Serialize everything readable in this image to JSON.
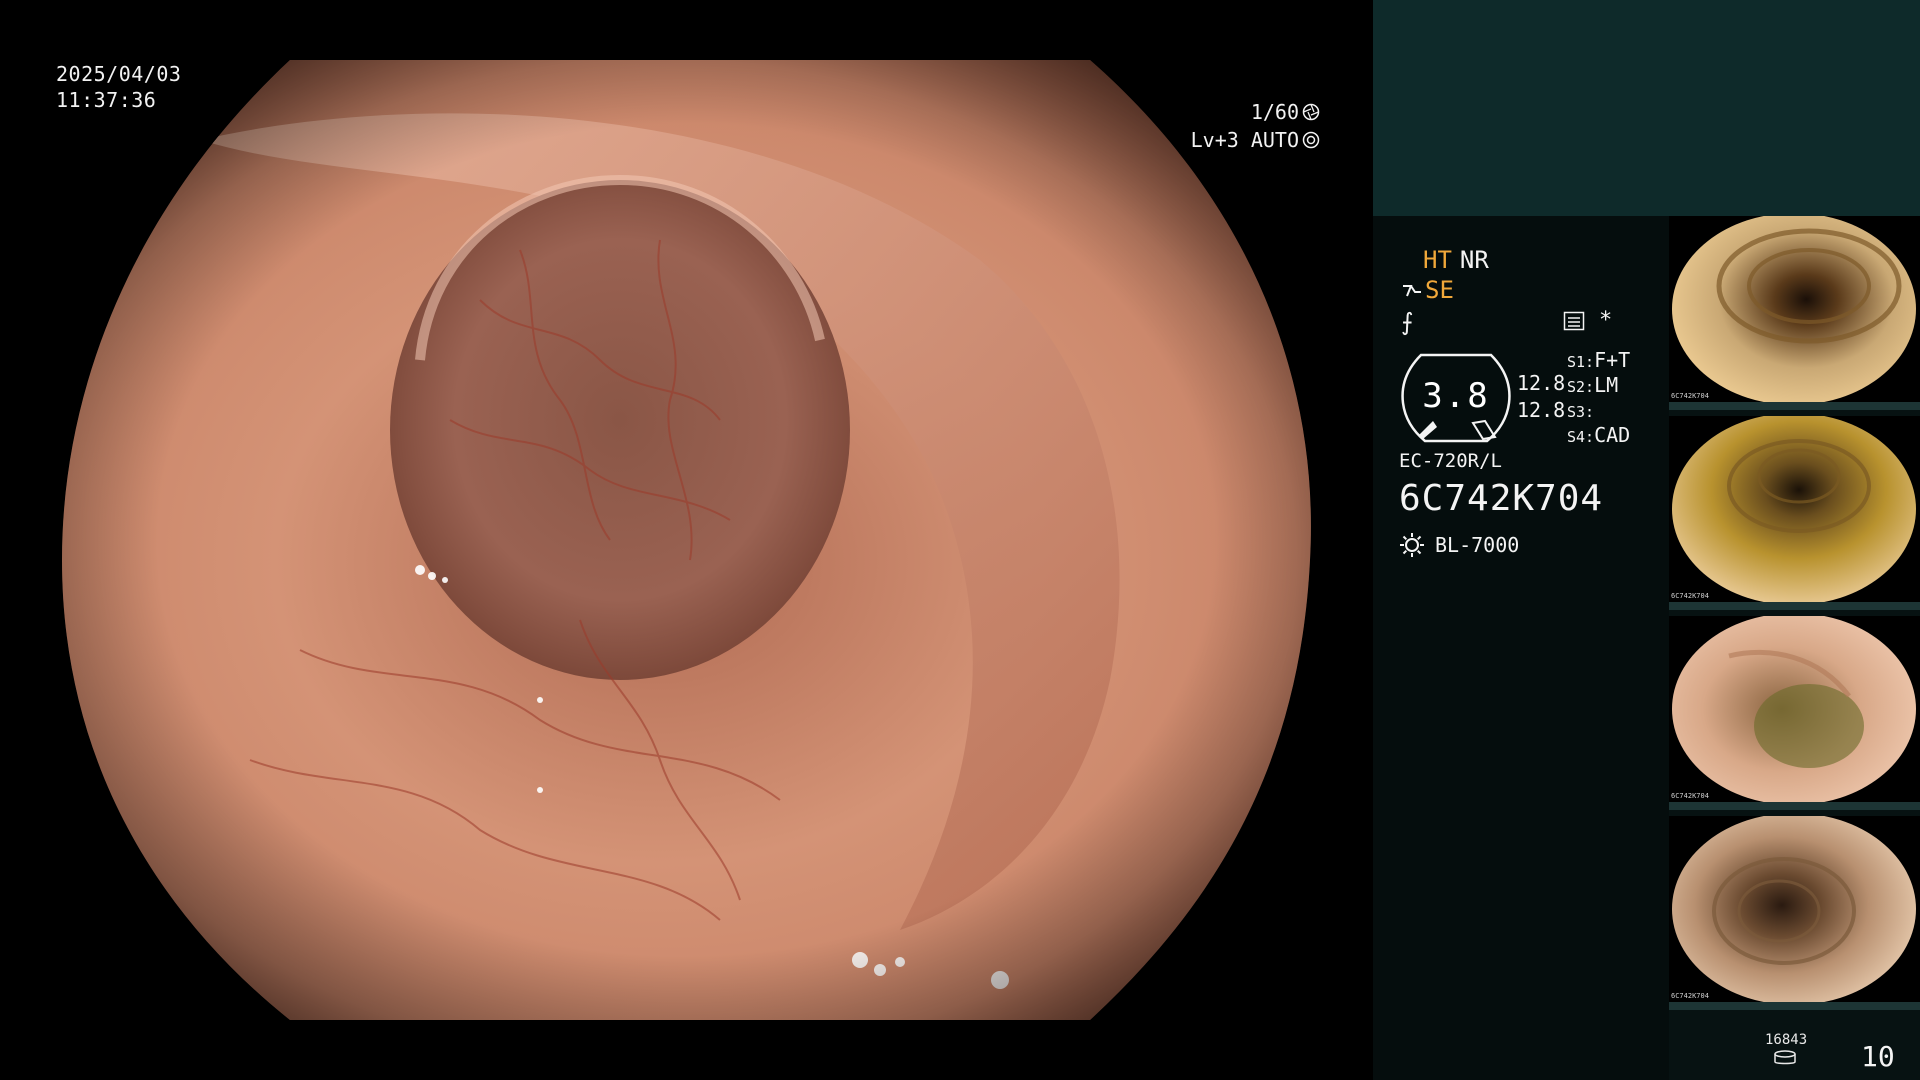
{
  "overlay": {
    "date": "2025/04/03",
    "time": "11:37:36",
    "shutter": "1/60",
    "level": "Lv+3 AUTO"
  },
  "panel": {
    "ht": "HT",
    "nr": "NR",
    "se": "SE",
    "f_mark": "⨍",
    "asterisk": "*",
    "gauge_value": "3.8",
    "zoom_1": "12.8",
    "zoom_2": "12.8",
    "switches": [
      {
        "key": "S1:",
        "value": "F+T"
      },
      {
        "key": "S2:",
        "value": "LM"
      },
      {
        "key": "S3:",
        "value": ""
      },
      {
        "key": "S4:",
        "value": "CAD"
      }
    ],
    "scope_model": "EC-720R/L",
    "serial": "6C742K704",
    "light_source": "BL-7000"
  },
  "thumbnails": [
    {
      "serial": "6C742K704"
    },
    {
      "serial": "6C742K704"
    },
    {
      "serial": "6C742K704"
    },
    {
      "serial": "6C742K704"
    }
  ],
  "counters": {
    "capture_count": "16843",
    "frame_count": "10"
  },
  "colors": {
    "panel_bg": "#071212",
    "panel_top_bg": "#0e2a2a",
    "accent_orange": "#f1a83a",
    "tissue": "#c98a6e"
  },
  "icons": {
    "shutter": "shutter-aperture-icon",
    "auto": "auto-iris-icon",
    "se": "structure-enhance-icon",
    "image_setting": "image-setting-icon",
    "light": "light-source-icon",
    "storage": "storage-disk-icon"
  }
}
